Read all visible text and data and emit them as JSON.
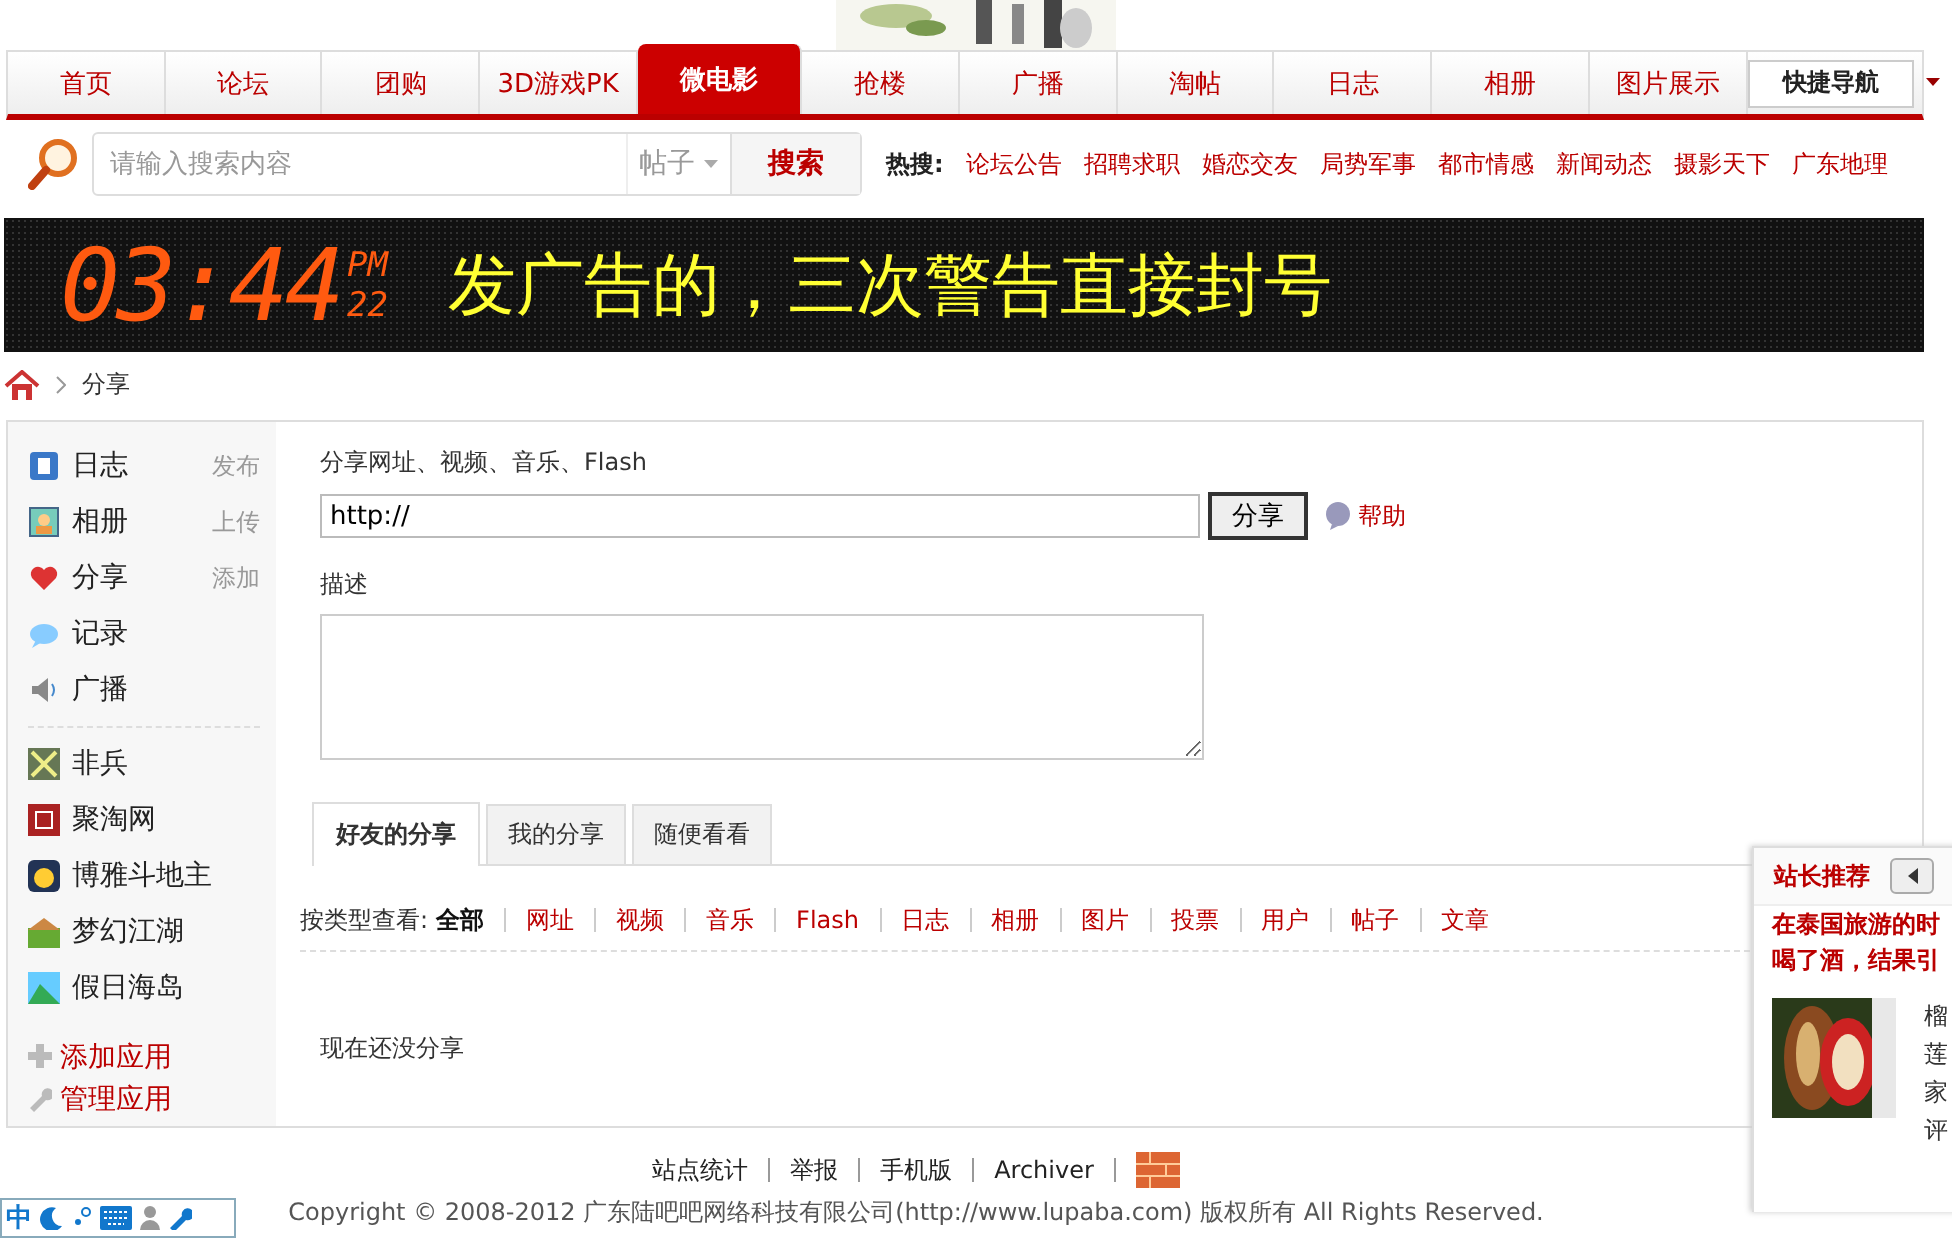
{
  "nav": {
    "items": [
      {
        "label": "首页",
        "selected": false
      },
      {
        "label": "论坛",
        "selected": false
      },
      {
        "label": "团购",
        "selected": false
      },
      {
        "label": "3D游戏PK",
        "selected": false
      },
      {
        "label": "微电影",
        "selected": true
      },
      {
        "label": "抢楼",
        "selected": false
      },
      {
        "label": "广播",
        "selected": false
      },
      {
        "label": "淘帖",
        "selected": false
      },
      {
        "label": "日志",
        "selected": false
      },
      {
        "label": "相册",
        "selected": false
      },
      {
        "label": "图片展示",
        "selected": false
      }
    ],
    "quick_nav": "快捷导航"
  },
  "search": {
    "placeholder": "请输入搜索内容",
    "scope": "帖子",
    "button": "搜索",
    "hot_label": "热搜:",
    "hot": [
      "论坛公告",
      "招聘求职",
      "婚恋交友",
      "局势军事",
      "都市情感",
      "新闻动态",
      "摄影天下",
      "广东地理"
    ]
  },
  "banner": {
    "time": "03:44",
    "ampm": "PM",
    "seconds": "22",
    "message": "发广告的，三次警告直接封号"
  },
  "breadcrumb": [
    "分享"
  ],
  "sidebar": {
    "apps": [
      {
        "label": "日志",
        "action": "发布"
      },
      {
        "label": "相册",
        "action": "上传"
      },
      {
        "label": "分享",
        "action": "添加"
      },
      {
        "label": "记录"
      },
      {
        "label": "广播"
      }
    ],
    "games": [
      "非兵",
      "聚淘网",
      "博雅斗地主",
      "梦幻江湖",
      "假日海岛"
    ],
    "links": [
      "添加应用",
      "管理应用"
    ]
  },
  "form": {
    "url_label": "分享网址、视频、音乐、Flash",
    "url_value": "http://",
    "submit": "分享",
    "help": "帮助",
    "desc_label": "描述"
  },
  "tabs": [
    {
      "label": "好友的分享",
      "selected": true
    },
    {
      "label": "我的分享",
      "selected": false
    },
    {
      "label": "随便看看",
      "selected": false
    }
  ],
  "filter": {
    "label": "按类型查看:",
    "types": [
      {
        "label": "全部",
        "selected": true
      },
      {
        "label": "网址",
        "selected": false
      },
      {
        "label": "视频",
        "selected": false
      },
      {
        "label": "音乐",
        "selected": false
      },
      {
        "label": "Flash",
        "selected": false
      },
      {
        "label": "日志",
        "selected": false
      },
      {
        "label": "相册",
        "selected": false
      },
      {
        "label": "图片",
        "selected": false
      },
      {
        "label": "投票",
        "selected": false
      },
      {
        "label": "用户",
        "selected": false
      },
      {
        "label": "帖子",
        "selected": false
      },
      {
        "label": "文章",
        "selected": false
      }
    ]
  },
  "empty_message": "现在还没分享",
  "footer": {
    "links": [
      "站点统计",
      "举报",
      "手机版",
      "Archiver"
    ],
    "copyright": "Copyright © 2008-2012 广东陆吧吧网络科技有限公司(http://www.lupaba.com) 版权所有 All Rights Reserved."
  },
  "ime": {
    "label": "中"
  },
  "popup": {
    "title": "站长推荐",
    "headline": [
      "在泰国旅游的时",
      "喝了酒，结果引"
    ],
    "side_text": [
      "榴",
      "莲",
      "家",
      "评"
    ]
  }
}
